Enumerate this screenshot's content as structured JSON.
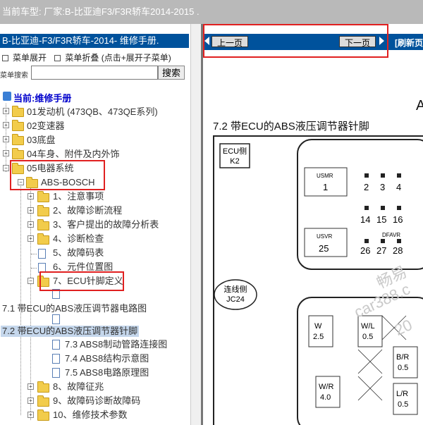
{
  "topbar": {
    "text": "当前车型:   厂家:B-比亚迪F3/F3R轿车2014-2015  ."
  },
  "left_pane": {
    "title": "B-比亚迪-F3/F3R轿车-2014- 维修手册.",
    "menu_expand": "菜单展开",
    "menu_collapse": "菜单折叠 (点击+展开子菜单)",
    "search_label": "菜单搜索",
    "search_value": "",
    "search_button": "搜索",
    "root_label": "当前:维修手册",
    "tree": [
      {
        "label": "01发动机 (473QB、473QE系列)"
      },
      {
        "label": "02变速器"
      },
      {
        "label": "03底盘"
      },
      {
        "label": "04车身、附件及内外饰"
      },
      {
        "label": "05电器系统"
      },
      {
        "label": "ABS-BOSCH"
      },
      {
        "label": "1、注意事项"
      },
      {
        "label": "2、故障诊断流程"
      },
      {
        "label": "3、客户提出的故障分析表"
      },
      {
        "label": "4、诊断检查"
      },
      {
        "label": "5、故障码表"
      },
      {
        "label": "6、元件位置图"
      },
      {
        "label": "7、ECU针脚定义"
      },
      {
        "label": "7.1 带ECU的ABS液压调节器电路图"
      },
      {
        "label": "7.2 带ECU的ABS液压调节器针脚"
      },
      {
        "label": "7.3 ABS8制动管路连接图"
      },
      {
        "label": "7.4 ABS8结构示意图"
      },
      {
        "label": "7.5 ABS8电路原理图"
      },
      {
        "label": "8、故障征兆"
      },
      {
        "label": "9、故障码诊断故障码"
      },
      {
        "label": "10、维修技术参数"
      }
    ]
  },
  "right_pane": {
    "prev_button": "上一页",
    "next_button": "下一页",
    "refresh": "[刷新页",
    "doc_letter": "A",
    "doc_heading": "7.2 带ECU的ABS液压调节器针脚",
    "diagram": {
      "ecu_side": "ECU侧",
      "ecu_code": "K2",
      "pins": [
        {
          "name": "USMR",
          "num": "1"
        },
        {
          "name": "",
          "num": "2"
        },
        {
          "name": "",
          "num": "3"
        },
        {
          "name": "",
          "num": "4"
        },
        {
          "name": "",
          "num": "14"
        },
        {
          "name": "",
          "num": "15"
        },
        {
          "name": "",
          "num": "16"
        },
        {
          "name": "USVR",
          "num": "25"
        },
        {
          "name": "",
          "num": "26"
        },
        {
          "name": "DFAVR",
          "num": "27"
        },
        {
          "name": "",
          "num": "28"
        }
      ],
      "harness_side": "连线侧",
      "harness_code": "JC24",
      "fuses": [
        {
          "color": "W",
          "rating": "2.5"
        },
        {
          "color": "W/L",
          "rating": "0.5"
        },
        {
          "color": "B/R",
          "rating": "0.5"
        },
        {
          "color": "W/R",
          "rating": "4.0"
        },
        {
          "color": "L/R",
          "rating": "0.5"
        }
      ]
    },
    "watermark": {
      "brand": "畅易",
      "site": "car388.c",
      "digits": "20"
    }
  },
  "colors": {
    "header_blue": "#00529c",
    "highlight": "#e02020",
    "selection": "#c5d7ec"
  }
}
